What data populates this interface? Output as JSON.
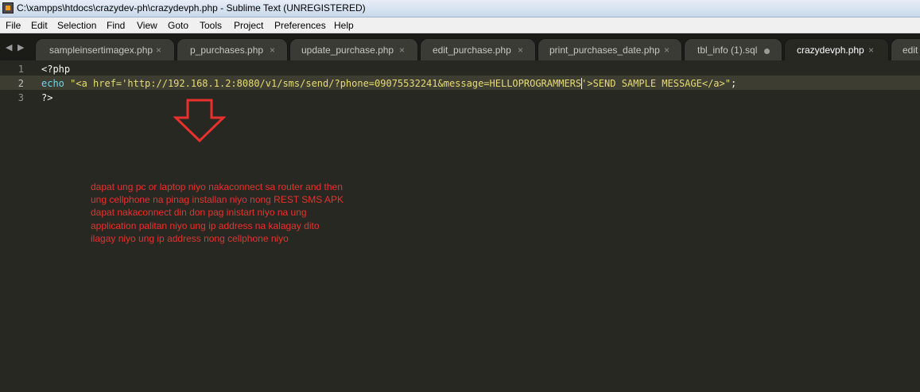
{
  "window": {
    "title": "C:\\xampps\\htdocs\\crazydev-ph\\crazydevph.php - Sublime Text (UNREGISTERED)"
  },
  "menu": [
    "File",
    "Edit",
    "Selection",
    "Find",
    "View",
    "Goto",
    "Tools",
    "Project",
    "Preferences",
    "Help"
  ],
  "tab_nav": {
    "prev": "◀",
    "next": "▶"
  },
  "tabs": [
    {
      "label": "sampleinsertimagex.php",
      "close": "×"
    },
    {
      "label": "p_purchases.php",
      "close": "×"
    },
    {
      "label": "update_purchase.php",
      "close": "×"
    },
    {
      "label": "edit_purchase.php",
      "close": "×"
    },
    {
      "label": "print_purchases_date.php",
      "close": "×"
    },
    {
      "label": "tbl_info (1).sql",
      "modified": true
    },
    {
      "label": "crazydevph.php",
      "close": "×",
      "active": true
    },
    {
      "label": "edit"
    }
  ],
  "editor": {
    "line_numbers": [
      "1",
      "2",
      "3"
    ],
    "current_line": 2,
    "code": {
      "line1": "<?php",
      "line2_keyword": "echo",
      "line2_str_a": " \"<a href='http://192.168.1.2:8080/v1/sms/send/?phone=09075532241&message=HELLOPROGRAMMERS",
      "line2_str_b": "'>SEND SAMPLE MESSAGE</a>\"",
      "line2_end": ";",
      "line3": "?>"
    }
  },
  "annotation": {
    "lines": [
      "dapat ung pc or laptop niyo nakaconnect sa router and then",
      "ung cellphone na pinag installan niyo nong REST SMS APK",
      "dapat nakaconnect din don pag inistart niyo na ung",
      "application palitan niyo ung ip address na kalagay dito",
      "ilagay niyo ung ip address nong cellphone niyo"
    ],
    "color": "#e8312f"
  },
  "colors": {
    "editor_bg": "#272822",
    "keyword": "#66d9ef",
    "string": "#e6db74"
  }
}
